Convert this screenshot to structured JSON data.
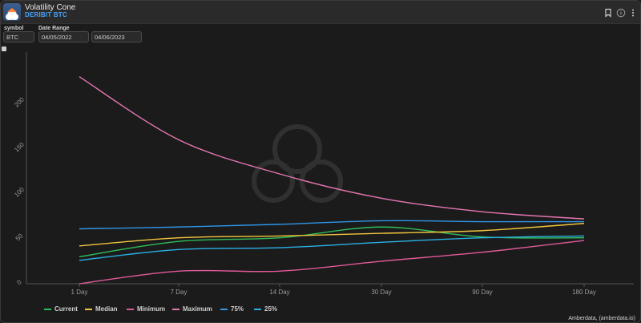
{
  "window": {
    "title": "Volatility Cone",
    "subtitle": "DERIBIT BTC",
    "icons": [
      "bookmark-icon",
      "info-icon",
      "more-vertical-icon"
    ]
  },
  "controls": {
    "symbol": {
      "label": "symbol",
      "value": "BTC"
    },
    "date_range": {
      "label": "Date Range",
      "start": "04/05/2022",
      "end": "04/06/2023"
    }
  },
  "credit": "Amberdata, (amberdata.io)",
  "chart_data": {
    "type": "line",
    "title": "",
    "xlabel": "",
    "ylabel": "",
    "categories": [
      "1 Day",
      "7 Day",
      "14 Day",
      "30 Day",
      "90 Day",
      "180 Day"
    ],
    "yticks": [
      0,
      50,
      100,
      150,
      200
    ],
    "ylim": [
      0,
      240
    ],
    "grid": false,
    "legend_position": "bottom-left",
    "series": [
      {
        "name": "Current",
        "color": "#2fbd5a",
        "values": [
          30,
          47,
          51,
          63,
          52,
          51
        ]
      },
      {
        "name": "Median",
        "color": "#f2c53d",
        "values": [
          42,
          51,
          53,
          56,
          59,
          67
        ]
      },
      {
        "name": "Minimum",
        "color": "#e05a9a",
        "values": [
          0,
          14,
          14,
          25,
          35,
          48
        ]
      },
      {
        "name": "Maximum",
        "color": "#e576b2",
        "values": [
          230,
          160,
          122,
          95,
          80,
          72
        ]
      },
      {
        "name": "75%",
        "color": "#2f96e8",
        "values": [
          61,
          63,
          66,
          70,
          69,
          69
        ]
      },
      {
        "name": "25%",
        "color": "#2bb0e6",
        "values": [
          26,
          38,
          40,
          46,
          51,
          53
        ]
      }
    ]
  }
}
